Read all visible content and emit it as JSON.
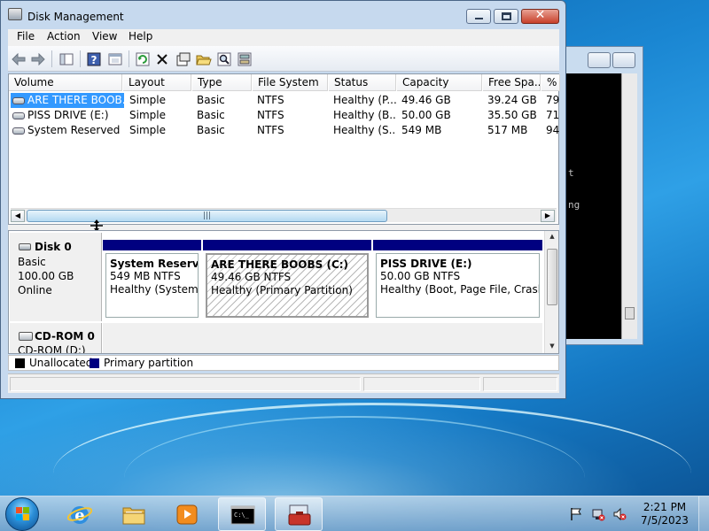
{
  "window": {
    "title": "Disk Management",
    "close_glyph": "✕"
  },
  "menu": [
    "File",
    "Action",
    "View",
    "Help"
  ],
  "toolbar": {
    "icons": [
      "back-icon",
      "forward-icon",
      "show-hide-tree-icon",
      "help-icon",
      "properties-icon",
      "refresh-icon",
      "delete-icon",
      "export-icon",
      "open-icon",
      "search-icon",
      "settings-icon"
    ]
  },
  "volume_list": {
    "columns": [
      "Volume",
      "Layout",
      "Type",
      "File System",
      "Status",
      "Capacity",
      "Free Spa...",
      "% F"
    ],
    "rows": [
      {
        "volume": "ARE THERE BOOB...",
        "layout": "Simple",
        "type": "Basic",
        "fs": "NTFS",
        "status": "Healthy (P...",
        "capacity": "49.46 GB",
        "free": "39.24 GB",
        "pct": "79"
      },
      {
        "volume": "PISS DRIVE (E:)",
        "layout": "Simple",
        "type": "Basic",
        "fs": "NTFS",
        "status": "Healthy (B...",
        "capacity": "50.00 GB",
        "free": "35.50 GB",
        "pct": "71"
      },
      {
        "volume": "System Reserved",
        "layout": "Simple",
        "type": "Basic",
        "fs": "NTFS",
        "status": "Healthy (S...",
        "capacity": "549 MB",
        "free": "517 MB",
        "pct": "94"
      }
    ],
    "scroll_left": "◀",
    "scroll_right": "▶",
    "scroll_grip": "|||"
  },
  "disks": {
    "disk0": {
      "name": "Disk 0",
      "type": "Basic",
      "size": "100.00 GB",
      "state": "Online",
      "partitions": [
        {
          "title": "System Reserved",
          "size": "549 MB NTFS",
          "status": "Healthy (System, A"
        },
        {
          "title": "ARE THERE BOOBS  (C:)",
          "size": "49.46 GB NTFS",
          "status": "Healthy (Primary Partition)"
        },
        {
          "title": "PISS DRIVE  (E:)",
          "size": "50.00 GB NTFS",
          "status": "Healthy (Boot, Page File, Crash Du"
        }
      ]
    },
    "cdrom0": {
      "name": "CD-ROM 0",
      "drive": "CD-ROM (D:)"
    },
    "scroll_up": "▲",
    "scroll_down": "▼"
  },
  "legend": [
    {
      "label": "Unallocated",
      "color": "#000000"
    },
    {
      "label": "Primary partition",
      "color": "#000080"
    }
  ],
  "console": {
    "lines": [
      "t",
      "ng"
    ]
  },
  "taskbar": {
    "apps": [
      "internet-explorer-icon",
      "windows-explorer-icon",
      "media-player-icon",
      "command-prompt-icon",
      "computer-management-icon"
    ],
    "clock_time": "2:21 PM",
    "clock_date": "7/5/2023"
  },
  "colors": {
    "primary_partition": "#000080",
    "selection": "#3399ff"
  }
}
